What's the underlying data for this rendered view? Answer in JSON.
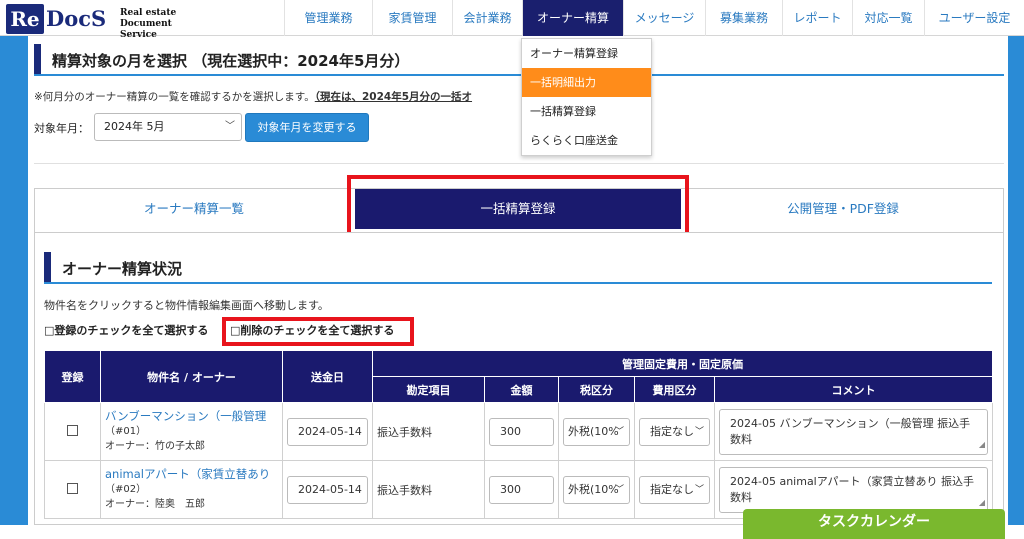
{
  "brand": {
    "logo_re": "Re",
    "logo_docs": "DocS",
    "logo_sub1": "Real estate",
    "logo_sub2": "Document Service"
  },
  "nav": [
    "管理業務",
    "家賃管理",
    "会計業務",
    "オーナー精算",
    "メッセージ",
    "募集業務",
    "レポート",
    "対応一覧",
    "ユーザー設定"
  ],
  "dropdown": [
    "オーナー精算登録",
    "一括明細出力",
    "一括精算登録",
    "らくらく口座送金"
  ],
  "header": {
    "title": "精算対象の月を選択 （現在選択中：2024年5月分）"
  },
  "note": {
    "prefix": "※何月分のオーナー精算の一覧を確認するかを選択します。",
    "bold": "（現在は、2024年5月分の一括オ",
    "tail": "）"
  },
  "month": {
    "label": "対象年月：",
    "value": "2024年 5月",
    "button": "対象年月を変更する"
  },
  "tabs": [
    "オーナー精算一覧",
    "一括精算登録",
    "公開管理・PDF登録"
  ],
  "status": {
    "title": "オーナー精算状況",
    "note": "物件名をクリックすると物件情報編集画面へ移動します。",
    "check_register_all": "□登録のチェックを全て選択する",
    "check_delete_all": "□削除のチェックを全て選択する"
  },
  "table": {
    "headers": {
      "register": "登録",
      "property": "物件名 / オーナー",
      "date": "送金日",
      "group": "管理固定費用・固定原価",
      "item": "勘定項目",
      "amount": "金額",
      "tax": "税区分",
      "cost": "費用区分",
      "comment": "コメント"
    },
    "rows": [
      {
        "name": "バンブーマンション（一般管理",
        "code": "（#01）",
        "owner": "オーナー：竹の子太郎",
        "date": "2024-05-14",
        "item": "振込手数料",
        "amount": "300",
        "tax": "外税(10%",
        "cost": "指定なし",
        "comment": "2024-05 バンブーマンション（一般管理 振込手数料"
      },
      {
        "name": "animalアパート（家賃立替あり",
        "code": "（#02）",
        "owner": "オーナー：陸奥　五郎",
        "date": "2024-05-14",
        "item": "振込手数料",
        "amount": "300",
        "tax": "外税(10%",
        "cost": "指定なし",
        "comment": "2024-05 animalアパート（家賃立替あり 振込手数料"
      }
    ]
  },
  "task_button": "タスクカレンダー",
  "colors": {
    "navy": "#1a1a6e",
    "blue": "#2a8bd6",
    "orange": "#ff8c1a",
    "red": "#e8141c",
    "green": "#7ab82e"
  }
}
